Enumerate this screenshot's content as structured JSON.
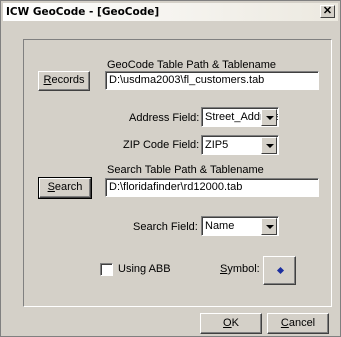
{
  "window": {
    "title": "ICW GeoCode - [GeoCode]",
    "close_label": "✕"
  },
  "records": {
    "button_label_ul": "R",
    "button_label_rest": "ecords"
  },
  "geocode_table": {
    "label": "GeoCode Table Path & Tablename",
    "value": "D:\\usdma2003\\fl_customers.tab"
  },
  "address_field": {
    "label": "Address Field:",
    "value": "Street_Address"
  },
  "zip_field": {
    "label": "ZIP Code Field:",
    "value": "ZIP5"
  },
  "search": {
    "button_label_ul": "S",
    "button_label_rest": "earch"
  },
  "search_table": {
    "label": "Search Table Path & Tablename",
    "value": "D:\\floridafinder\\rd12000.tab"
  },
  "search_field": {
    "label": "Search Field:",
    "value": "Name"
  },
  "using_abb": {
    "label": "Using ABB",
    "checked": false
  },
  "symbol": {
    "label_ul": "S",
    "label_rest": "ymbol:",
    "icon": "diamond-icon",
    "color": "#1c2fa0"
  },
  "footer": {
    "ok_ul": "O",
    "ok_rest": "K",
    "cancel_ul": "C",
    "cancel_rest": "ancel"
  }
}
